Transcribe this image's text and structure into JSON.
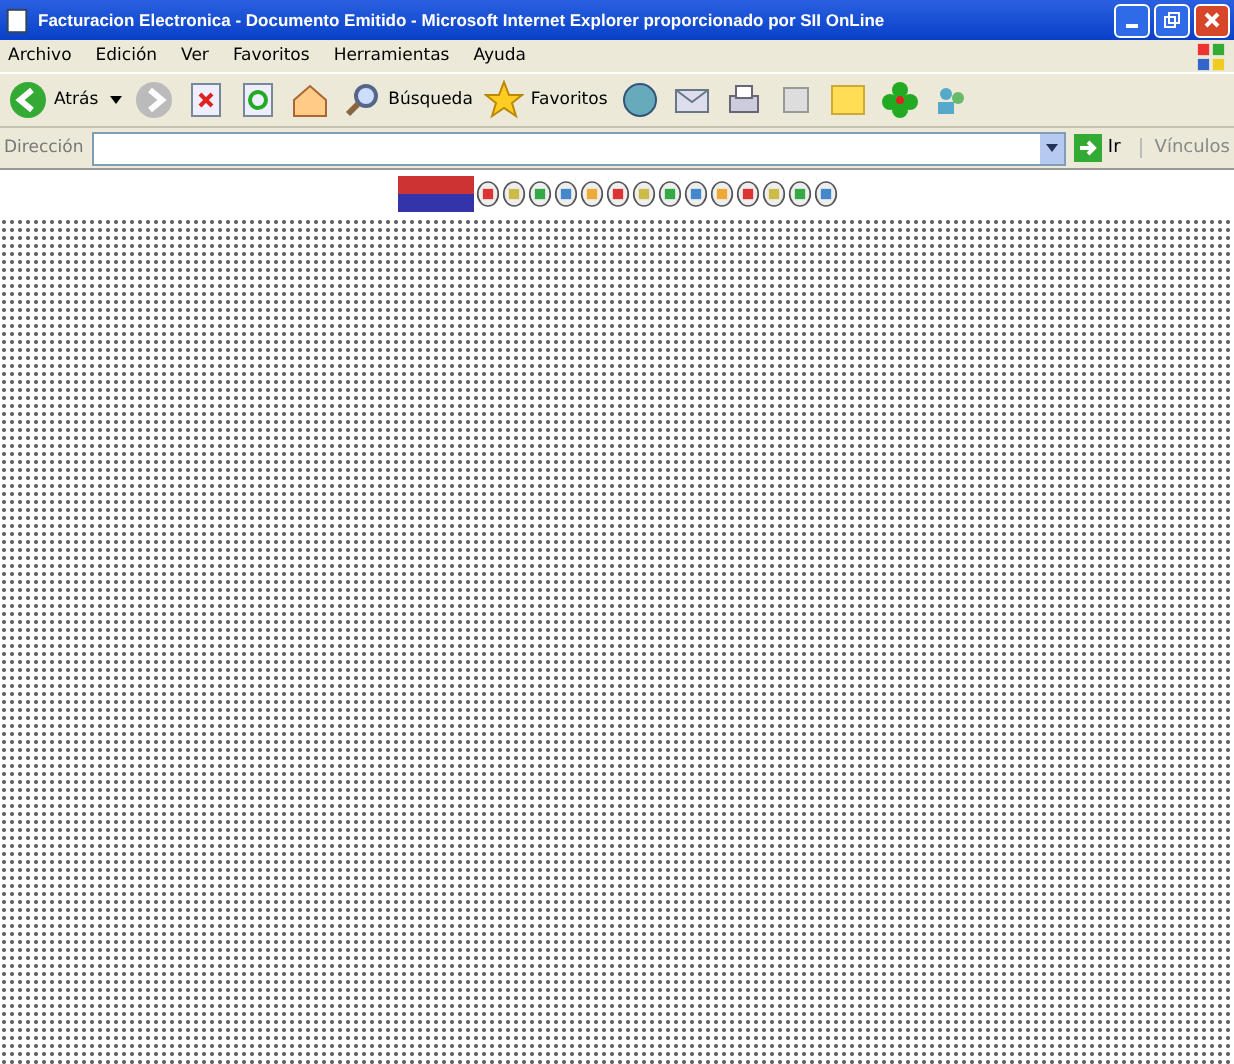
{
  "window": {
    "title": "Facturacion Electronica - Documento Emitido - Microsoft Internet Explorer proporcionado por SII OnLine"
  },
  "menu": [
    "Archivo",
    "Edición",
    "Ver",
    "Favoritos",
    "Herramientas",
    "Ayuda"
  ],
  "toolbar": {
    "back": "Atrás",
    "search": "Búsqueda",
    "favorites": "Favoritos"
  },
  "address_bar": {
    "label": "Dirección",
    "go": "Ir",
    "links": "Vínculos"
  }
}
